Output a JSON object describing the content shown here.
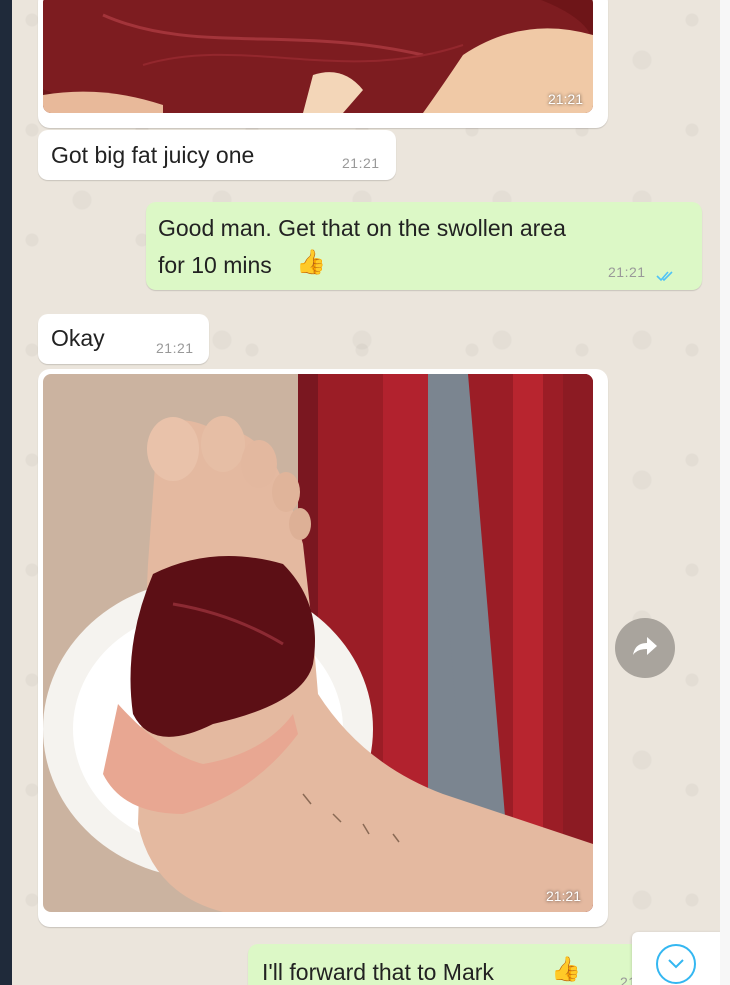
{
  "messages": [
    {
      "id": "m1",
      "direction": "incoming",
      "type": "photo",
      "subject": "raw steak",
      "time": "21:21"
    },
    {
      "id": "m2",
      "direction": "incoming",
      "type": "text",
      "text": "Got big fat juicy one",
      "time": "21:21"
    },
    {
      "id": "m3",
      "direction": "outgoing",
      "type": "text",
      "line1": "Good man. Get that on the swollen area",
      "line2": "for 10 mins",
      "emoji": "thumbs-up",
      "time": "21:21",
      "status": "read"
    },
    {
      "id": "m4",
      "direction": "incoming",
      "type": "text",
      "text": "Okay",
      "time": "21:21"
    },
    {
      "id": "m5",
      "direction": "incoming",
      "type": "photo",
      "subject": "steak wrapped on foot over plate",
      "time": "21:21"
    },
    {
      "id": "m6",
      "direction": "outgoing",
      "type": "text",
      "text": "I'll forward that to Mark",
      "emoji": "thumbs-up",
      "time": "21"
    }
  ],
  "icons": {
    "forward": "forward-arrow-icon",
    "scroll_down": "chevron-down-icon",
    "read_receipt": "double-check-icon"
  },
  "colors": {
    "chat_bg": "#ebe5dc",
    "outgoing_bubble": "#dcf8c6",
    "incoming_bubble": "#ffffff",
    "read_tick": "#4fc3f7"
  }
}
